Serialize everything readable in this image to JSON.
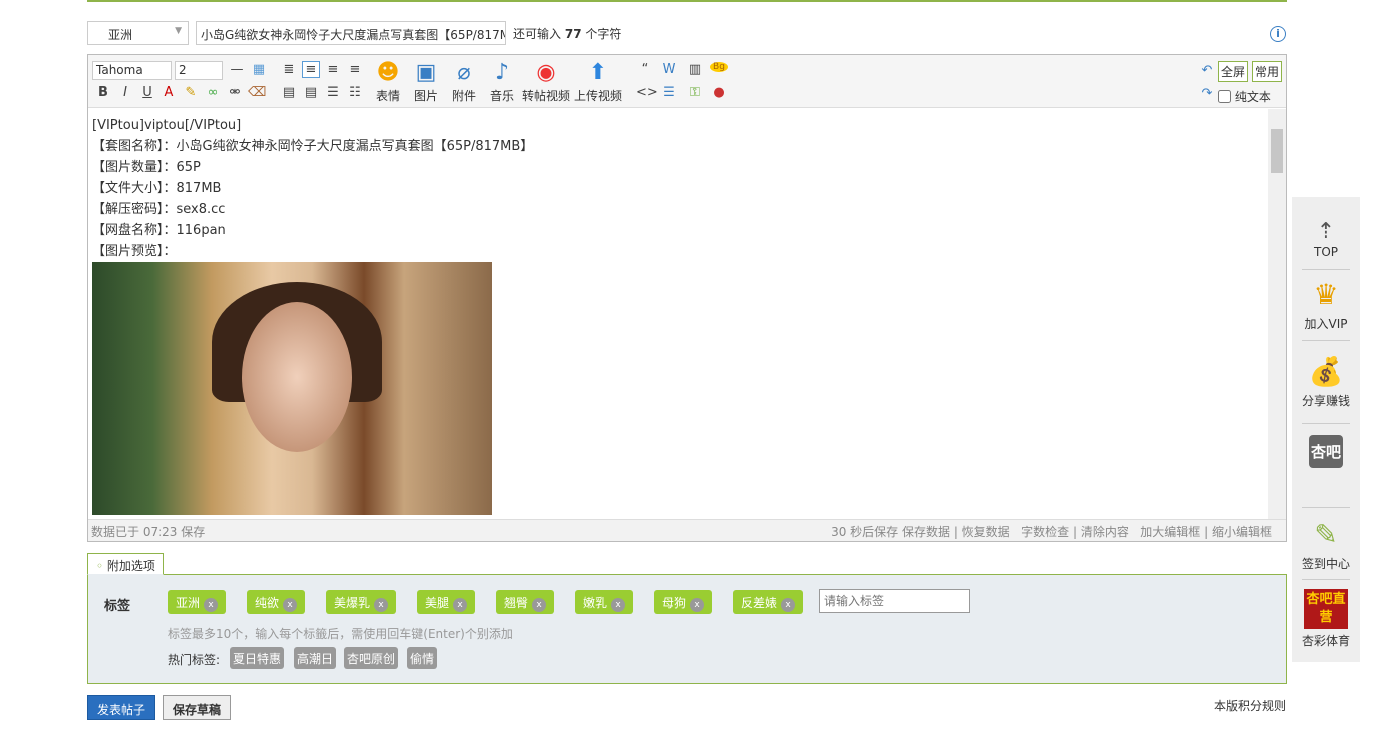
{
  "category_select": "亚洲",
  "title_value": "小岛G纯欲女神永岡怜子大尺度漏点写真套图【65P/817M",
  "remaining": {
    "prefix": "还可输入",
    "count": "77",
    "suffix": "个字符"
  },
  "toolbar": {
    "font": "Tahoma",
    "size": "2",
    "emoji": "表情",
    "image": "图片",
    "attach": "附件",
    "music": "音乐",
    "repost_video": "转帖视频",
    "upload_video": "上传视频",
    "fullscreen": "全屏",
    "common": "常用",
    "plain_text": "纯文本"
  },
  "content": {
    "lines": [
      "[VIPtou]viptou[/VIPtou]",
      "【套图名称】：小岛G纯欲女神永岡怜子大尺度漏点写真套图【65P/817MB】",
      "【图片数量】：65P",
      "【文件大小】：817MB",
      "【解压密码】：sex8.cc",
      "【网盘名称】：116pan",
      "【图片预览】："
    ]
  },
  "status": {
    "saved": "数据已于 07:23 保存",
    "autosave": "30 秒后保存",
    "save_data": "保存数据",
    "restore": "恢复数据",
    "word_check": "字数检查",
    "clear": "清除内容",
    "enlarge": "加大编辑框",
    "shrink": "缩小编辑框"
  },
  "extra_tab": "附加选项",
  "tags": {
    "label": "标签",
    "items": [
      "亚洲",
      "纯欲",
      "美爆乳",
      "美腿",
      "翘臀",
      "嫩乳",
      "母狗",
      "反差婊"
    ],
    "placeholder": "请输入标签",
    "hint": "标签最多10个，输入每个标籤后，需使用回车键(Enter)个别添加",
    "hot_label": "热门标签:",
    "hot": [
      "夏日特惠",
      "高潮日",
      "杏吧原创",
      "偷情"
    ]
  },
  "buttons": {
    "post": "发表帖子",
    "draft": "保存草稿",
    "rules": "本版积分规则"
  },
  "sidebar": {
    "top": "TOP",
    "vip": "加入VIP",
    "share": "分享赚钱",
    "logo": "杏吧",
    "checkin": "签到中心",
    "sports": "杏彩体育",
    "sports_logo": "杏吧直营"
  }
}
